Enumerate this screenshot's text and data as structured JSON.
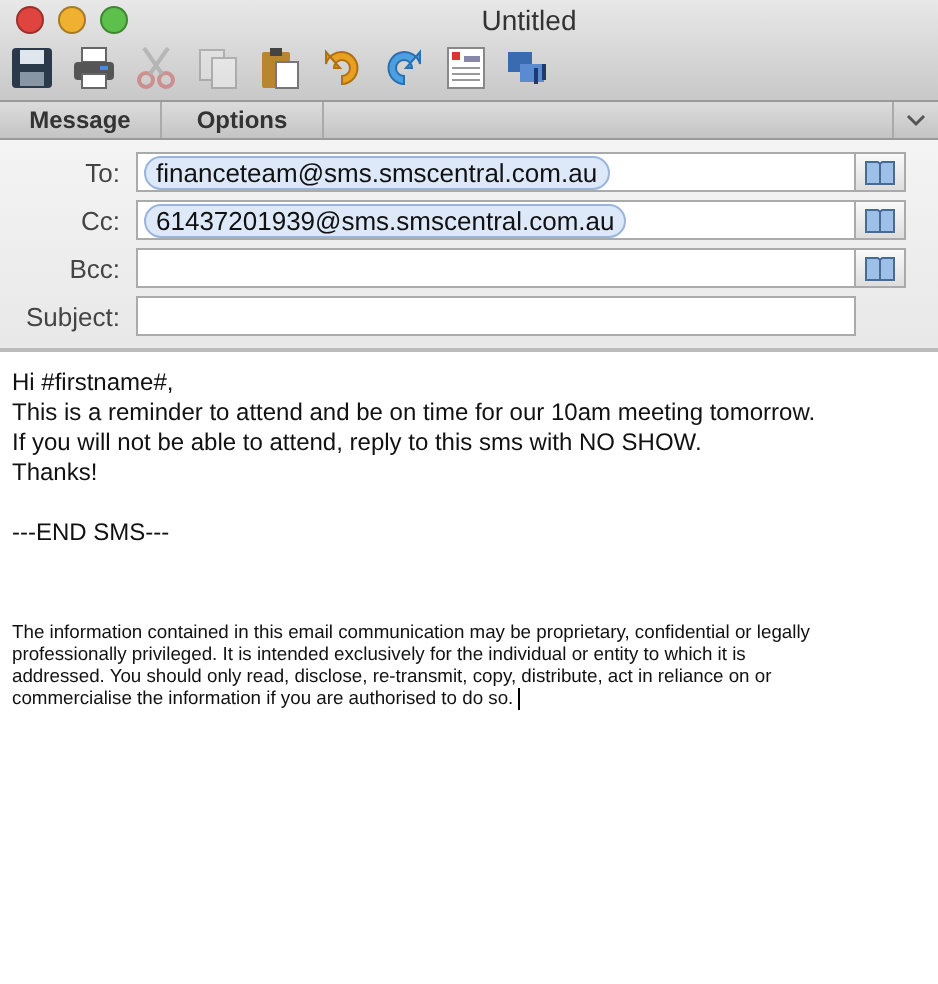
{
  "window": {
    "title": "Untitled"
  },
  "toolbar": [
    {
      "kind": "save",
      "disabled": false
    },
    {
      "kind": "print",
      "disabled": false
    },
    {
      "kind": "cut",
      "disabled": true
    },
    {
      "kind": "copy",
      "disabled": true
    },
    {
      "kind": "paste",
      "disabled": false
    },
    {
      "kind": "undo",
      "disabled": false
    },
    {
      "kind": "redo",
      "disabled": false
    },
    {
      "kind": "format",
      "disabled": false
    },
    {
      "kind": "media",
      "disabled": false
    }
  ],
  "tabs": [
    {
      "label": "Message"
    },
    {
      "label": "Options"
    }
  ],
  "fields": [
    {
      "label": "To:",
      "recipients": [
        "financeteam@sms.smscentral.com.au"
      ],
      "address_book": true
    },
    {
      "label": "Cc:",
      "recipients": [
        "61437201939@sms.smscentral.com.au"
      ],
      "address_book": true
    },
    {
      "label": "Bcc:",
      "address_book": true
    },
    {
      "label": "Subject:",
      "address_book": false
    }
  ],
  "body": {
    "lines": [
      "Hi #firstname#,",
      "This is a reminder to attend and be on time for our 10am meeting tomorrow.",
      "If you will not be able to attend, reply to this sms with NO SHOW.",
      "Thanks!",
      {
        "text": "---END SMS---",
        "gap_before": true
      }
    ],
    "disclaimer": [
      "The information contained in this email communication may be proprietary, confidential or legally",
      "professionally privileged. It is intended exclusively for the individual or entity to which it is",
      "addressed. You should only read, disclose, re-transmit, copy, distribute, act in reliance on or",
      "commercialise the information if you are authorised to do so."
    ]
  }
}
